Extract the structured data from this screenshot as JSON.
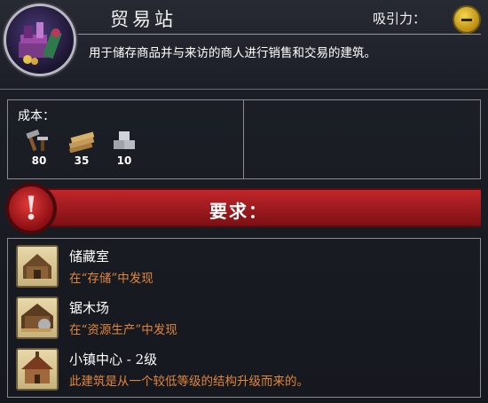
{
  "header": {
    "title": "贸易站",
    "attraction_label": "吸引力：",
    "description": "用于储存商品并与来访的商人进行销售和交易的建筑。"
  },
  "cost": {
    "label": "成本：",
    "resources": [
      {
        "icon": "hammer-tool-icon",
        "amount": "80"
      },
      {
        "icon": "wood-planks-icon",
        "amount": "35"
      },
      {
        "icon": "stone-blocks-icon",
        "amount": "10"
      }
    ]
  },
  "requirements": {
    "title": "要求：",
    "items": [
      {
        "name": "储藏室",
        "detail": "在“存储”中发现",
        "icon": "storage-room-icon"
      },
      {
        "name": "锯木场",
        "detail": "在“资源生产”中发现",
        "icon": "sawmill-icon"
      },
      {
        "name": "小镇中心 - 2级",
        "detail": "此建筑是从一个较低等级的结构升级而来的。",
        "icon": "town-center-icon"
      }
    ]
  },
  "colors": {
    "accent_red": "#c0262a",
    "detail_orange": "#e0853c",
    "button_gold": "#e0b52a"
  }
}
